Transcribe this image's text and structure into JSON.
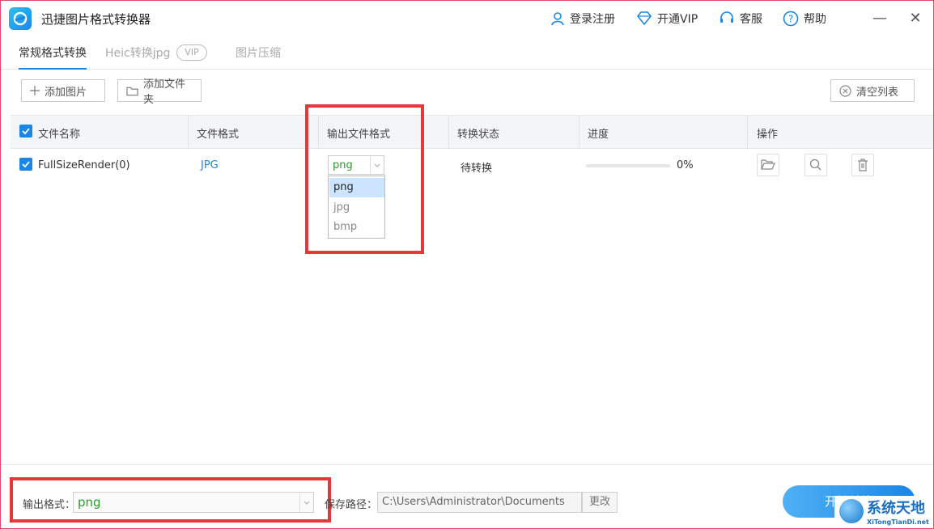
{
  "window": {
    "title": "迅捷图片格式转换器",
    "links": {
      "login": "登录注册",
      "vip": "开通VIP",
      "service": "客服",
      "help": "帮助"
    },
    "minimize": "—",
    "close": "✕"
  },
  "tabs": [
    {
      "label": "常规格式转换",
      "active": true
    },
    {
      "label": "Heic转换jpg",
      "badge": "VIP"
    },
    {
      "label": "图片压缩"
    }
  ],
  "toolbar": {
    "add_image": "添加图片",
    "add_folder": "添加文件夹",
    "clear_list": "清空列表"
  },
  "table": {
    "headers": {
      "name": "文件名称",
      "format": "文件格式",
      "output": "输出文件格式",
      "status": "转换状态",
      "progress": "进度",
      "actions": "操作"
    },
    "rows": [
      {
        "name": "FullSizeRender(0)",
        "format": "JPG",
        "output": "png",
        "status": "待转换",
        "progress_text": "0%",
        "progress": 0
      }
    ],
    "dropdown_options": [
      "png",
      "jpg",
      "bmp"
    ]
  },
  "bottom": {
    "output_format_label": "输出格式：",
    "output_format_value": "png",
    "save_path_label": "保存路径：",
    "save_path_value": "C:\\Users\\Administrator\\Documents",
    "change_label": "更改",
    "start_label": "开始转换"
  },
  "watermark": {
    "title": "系统天地",
    "sub": "XiTongTianDi.net"
  },
  "colors": {
    "accent": "#1a87e6",
    "highlight_box": "#e5383b",
    "format_green": "#2a9d2a"
  }
}
